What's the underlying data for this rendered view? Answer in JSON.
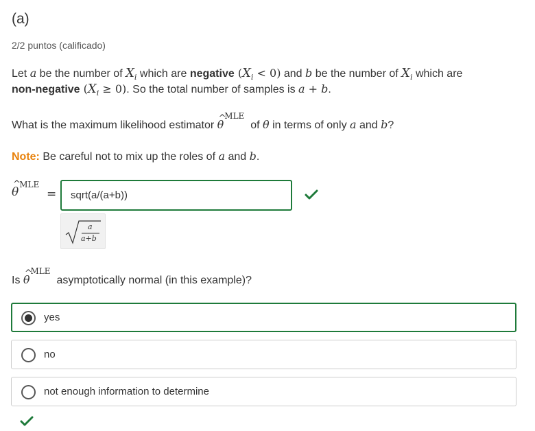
{
  "part_label": "(a)",
  "points": "2/2 puntos (calificado)",
  "q1": {
    "l1_a": "Let ",
    "var_a": "a",
    "l1_b": " be the number of ",
    "var_X": "X",
    "sub_i": "i",
    "l1_c": " which are ",
    "negative_word": "negative",
    "lt0": " < 0)",
    "l1_d": " and ",
    "var_b": "b",
    "l1_e": " be the number of ",
    "l1_f": " which are",
    "nonneg_word": "non-negative",
    "ge0": " ≥ 0)",
    "l2_a": ". So the total number of samples is ",
    "a_plus_b": "a + b",
    "period": "."
  },
  "q2": {
    "prefix": "What is the maximum likelihood estimator ",
    "theta": "θ",
    "mle": "MLE",
    "of": "of ",
    "mid": " in terms of only ",
    "and": " and ",
    "qmark": "?"
  },
  "note": {
    "label": "Note:",
    "text": " Be careful not to mix up the roles of ",
    "and": " and ",
    "period": "."
  },
  "answer": {
    "lhs_theta": "θ",
    "lhs_mle": "MLE",
    "equals": "=",
    "value": "sqrt(a/(a+b))",
    "preview_num": "a",
    "preview_den": "a+b"
  },
  "q3": {
    "is": "Is ",
    "theta": "θ",
    "mle": "MLE",
    "rest": "asymptotically normal (in this example)?"
  },
  "options": [
    {
      "label": "yes",
      "selected": true
    },
    {
      "label": "no",
      "selected": false
    },
    {
      "label": "not enough information to determine",
      "selected": false
    }
  ],
  "colors": {
    "correct": "#1e7a3a",
    "note": "#e8820c",
    "text": "#333333"
  }
}
